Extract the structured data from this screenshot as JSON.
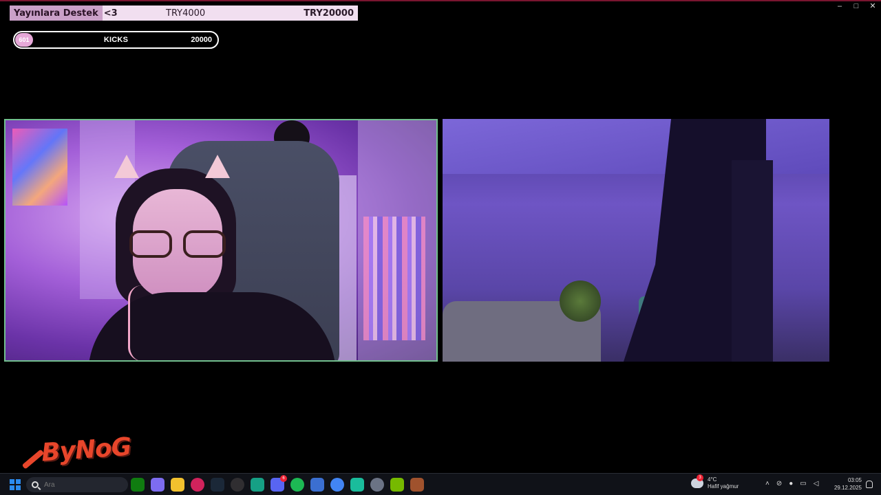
{
  "window": {
    "controls": [
      "–",
      "□",
      "✕"
    ]
  },
  "donation_goal": {
    "label": "Yayınlara Destek",
    "heart": "<3",
    "current": "TRY4000",
    "target": "TRY20000",
    "accent": "#caa0c8"
  },
  "kicks": {
    "count": "601",
    "title": "KICKS",
    "goal": "20000",
    "accent": "#e6a8d8"
  },
  "webcam_border": "#72c08e",
  "logo": {
    "text": "ByNoG",
    "color": "#e8462b"
  },
  "taskbar": {
    "search_placeholder": "Ara",
    "apps": [
      {
        "name": "xbox-icon",
        "badge": "",
        "color": "#107c10"
      },
      {
        "name": "copilot-icon",
        "badge": "",
        "color": "#7d6cf0"
      },
      {
        "name": "file-explorer-icon",
        "badge": "",
        "color": "#f2c12e"
      },
      {
        "name": "opera-gx-icon",
        "badge": "",
        "color": "#d1235c"
      },
      {
        "name": "steam-icon",
        "badge": "",
        "color": "#1b2838"
      },
      {
        "name": "obs-icon",
        "badge": "",
        "color": "#302e31"
      },
      {
        "name": "discord-canary-icon",
        "badge": "",
        "color": "#16a085"
      },
      {
        "name": "discord-icon",
        "badge": "6",
        "color": "#5865f2"
      },
      {
        "name": "spotify-icon",
        "badge": "",
        "color": "#1db954"
      },
      {
        "name": "app-icon",
        "badge": "",
        "color": "#3b6fd1"
      },
      {
        "name": "chrome-icon",
        "badge": "",
        "color": "#4285f4"
      },
      {
        "name": "discord-ptb-icon",
        "badge": "",
        "color": "#1abc9c"
      },
      {
        "name": "settings-icon",
        "badge": "",
        "color": "#6b7385"
      },
      {
        "name": "nvidia-icon",
        "badge": "",
        "color": "#76b900"
      },
      {
        "name": "winrar-icon",
        "badge": "",
        "color": "#a0522d"
      }
    ],
    "weather": {
      "badge": "3",
      "temp": "4°C",
      "desc": "Hafif yağmur"
    },
    "clock": {
      "time": "03:05",
      "date": "29.12.2025"
    }
  }
}
